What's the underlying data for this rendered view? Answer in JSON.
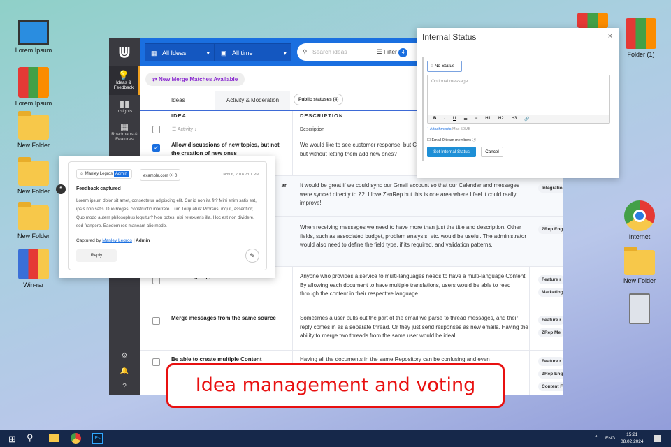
{
  "desktop": {
    "left_icons": [
      "Lorem Ipsum",
      "Lorem Ipsum",
      "New Folder",
      "New Folder",
      "New Folder",
      "Win-rar"
    ],
    "right_icons": [
      "Folder (1)",
      "Internet",
      "New Folder"
    ]
  },
  "app": {
    "sidebar": [
      "Ideas & Feedback",
      "Insights",
      "Roadmaps & Features"
    ],
    "topbar": {
      "view": "All Ideas",
      "time": "All time",
      "search_placeholder": "Search ideas",
      "filter": "Filter",
      "filter_count": "4"
    },
    "merge_banner": "New Merge Matches Available",
    "tabs": [
      "Ideas",
      "Activity & Moderation"
    ],
    "public_statuses": "Public statuses (4)",
    "columns": {
      "idea": "IDEA",
      "description": "DESCRIPTION",
      "sort": "Activity",
      "desc_sub": "Description"
    },
    "rows": [
      {
        "title": "Allow discussions of new topics, but not the creation of new ones",
        "desc": "We would like to see customer response, but Can you please make it possible for users to but without letting them add new ones?",
        "tags": []
      },
      {
        "title": "ar",
        "desc": "It would be great if we could sync our Gmail account so that our Calendar and messages were synced directly to Z2. I love ZenRep but this is one area where I feel it could really improve!",
        "tags": [
          "Integratio"
        ]
      },
      {
        "title": "",
        "desc": "When receiving messages we need to have more than just the title and description. Other fields, such as associated budget, problem analysis, etc. would be useful. The administrator would also need to define the field type, if its required, and validation patterns.",
        "tags": [
          "ZRep Eng"
        ]
      },
      {
        "title": "Multi-lang support for documents",
        "desc": "Anyone who provides a service to multi-languages needs to have a multi-language Content. By allowing each document to have multiple translations, users would be able to read through the content in their respective language.",
        "tags": [
          "Feature r",
          "Marketing"
        ]
      },
      {
        "title": "Merge messages from the same source",
        "desc": "Sometimes a user pulls out the part of the email we parse to thread messages, and their reply comes in as a separate thread. Or they just send responses as new emails. Having the ability to merge two threads from the same user would be ideal.",
        "tags": [
          "Feature r",
          "ZRep Me"
        ]
      },
      {
        "title": "Be able to create multiple Content",
        "desc": "Having all the documents in the same Repository can be confusing and even",
        "tags": [
          "Feature r",
          "ZRep Eng",
          "Content F"
        ]
      }
    ]
  },
  "card": {
    "user": "Manley Legros",
    "role_badge": "Admin",
    "domain": "example.com",
    "count": "0",
    "date": "Nov 6, 2018 7:01 PM",
    "heading": "Feedback captured",
    "body": "Lorem ipsum dolor sit amet, consectetur adipiscing elit. Cur id non ita fit? Mihi enim satis est, ipsis non satis. Duo Reges: constructio interrete. Tum Torquatus: Prorsus, inquit, assentior; Quo modo autem philosophus loquitur? Non potes, nisi retexueris illa. Hoc est non dividere, sed frangere. Eaedem res maneant alio modo.",
    "captured_by": "Captured by",
    "captured_user": "Manley Legros",
    "captured_role": "| Admin",
    "reply": "Reply"
  },
  "dialog": {
    "title": "Internal Status",
    "status": "No Status",
    "placeholder": "Optional message...",
    "toolbar": [
      "B",
      "I",
      "U",
      "☰",
      "≡",
      "H1",
      "H2",
      "H3",
      "🔗"
    ],
    "attachments": "Attachments",
    "max": "Max 50MB",
    "email": "Email 0 team members",
    "submit": "Set Internal Status",
    "cancel": "Cancel"
  },
  "banner": "Idea management and voting",
  "taskbar": {
    "lang": "ENG",
    "time": "15:21",
    "date": "08.02.2024"
  }
}
